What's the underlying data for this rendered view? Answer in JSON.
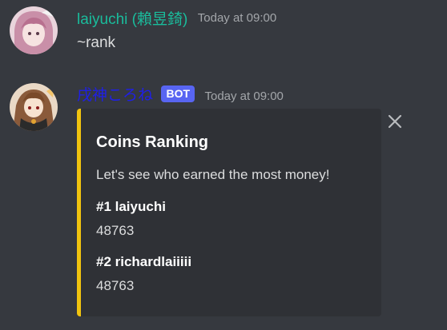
{
  "messages": [
    {
      "author": "laiyuchi (賴昱錡)",
      "timestamp": "Today at 09:00",
      "content": "~rank"
    },
    {
      "author": "戌神ころね",
      "badge": "BOT",
      "timestamp": "Today at 09:00",
      "embed": {
        "title": "Coins Ranking",
        "description": "Let's see who earned the most money!",
        "fields": [
          {
            "name": "#1 laiyuchi",
            "value": "48763"
          },
          {
            "name": "#2 richardlaiiiii",
            "value": "48763"
          }
        ],
        "accent_color": "#f1c40f"
      }
    }
  ],
  "icons": {
    "close": "close-icon"
  },
  "colors": {
    "background": "#36393f",
    "embed_background": "#2f3136",
    "human_username": "#1abc9c",
    "bot_username": "#1f1fe8",
    "bot_badge": "#5865f2"
  }
}
